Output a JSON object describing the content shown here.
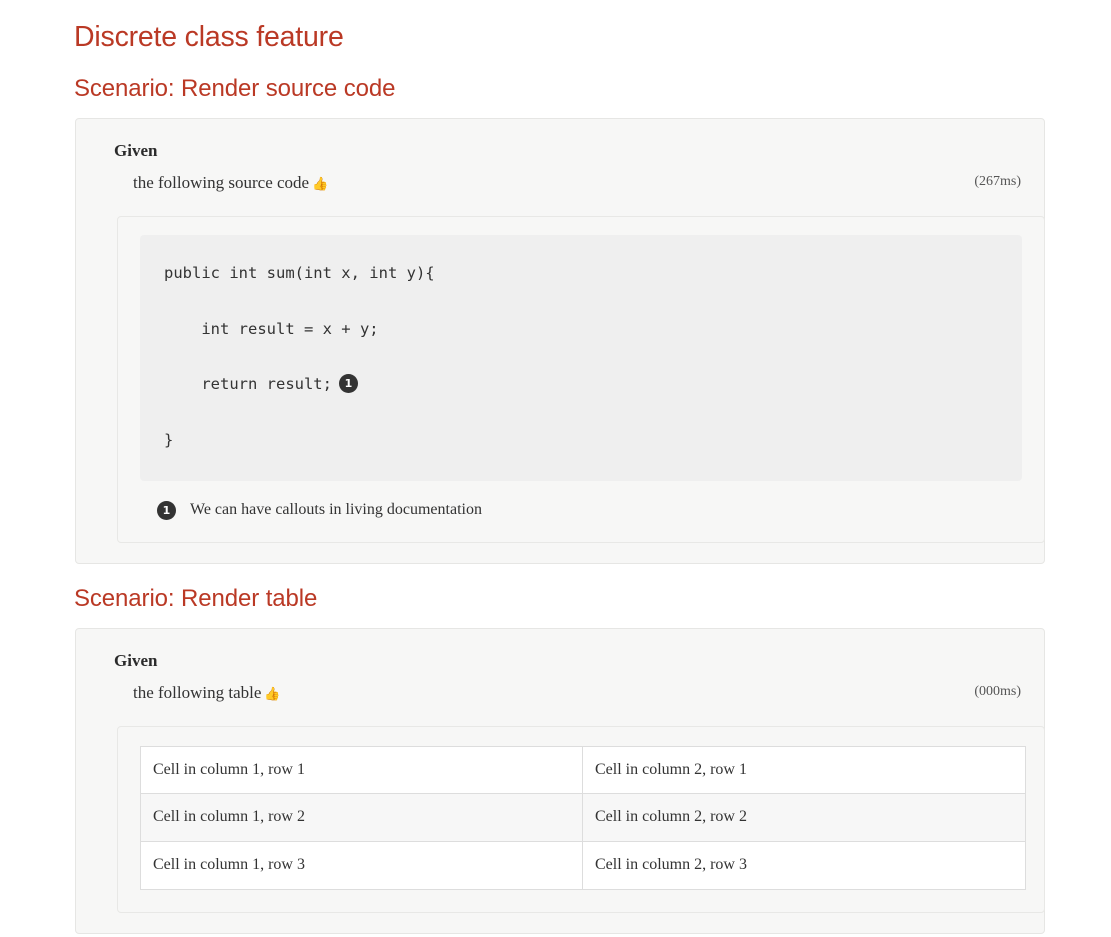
{
  "feature": {
    "title": "Discrete class feature"
  },
  "theme": {
    "heading_color": "#ba3925",
    "panel_bg": "#f7f7f6",
    "code_bg": "#efefef",
    "callout_bg": "#333333",
    "pass_icon_color": "#1f7a1f",
    "table_stripe": "#f7f7f7"
  },
  "icons": {
    "thumbs_up": "👍"
  },
  "scenarios": [
    {
      "title": "Scenario: Render source code",
      "step": {
        "keyword": "Given",
        "text": "the following source code",
        "status_icon": "thumbs-up-icon",
        "duration": "(267ms)"
      },
      "source_code": {
        "language": "java",
        "lines": [
          "public int sum(int x, int y){",
          "",
          "    int result = x + y;",
          "",
          "    return result;",
          "",
          "}"
        ],
        "callout_on_line_index": 4,
        "callout_marker": "1"
      },
      "callouts": [
        {
          "marker": "1",
          "text": "We can have callouts in living documentation"
        }
      ]
    },
    {
      "title": "Scenario: Render table",
      "step": {
        "keyword": "Given",
        "text": "the following table",
        "status_icon": "thumbs-up-icon",
        "duration": "(000ms)"
      },
      "table": {
        "rows": [
          [
            "Cell in column 1, row 1",
            "Cell in column 2, row 1"
          ],
          [
            "Cell in column 1, row 2",
            "Cell in column 2, row 2"
          ],
          [
            "Cell in column 1, row 3",
            "Cell in column 2, row 3"
          ]
        ]
      }
    }
  ]
}
